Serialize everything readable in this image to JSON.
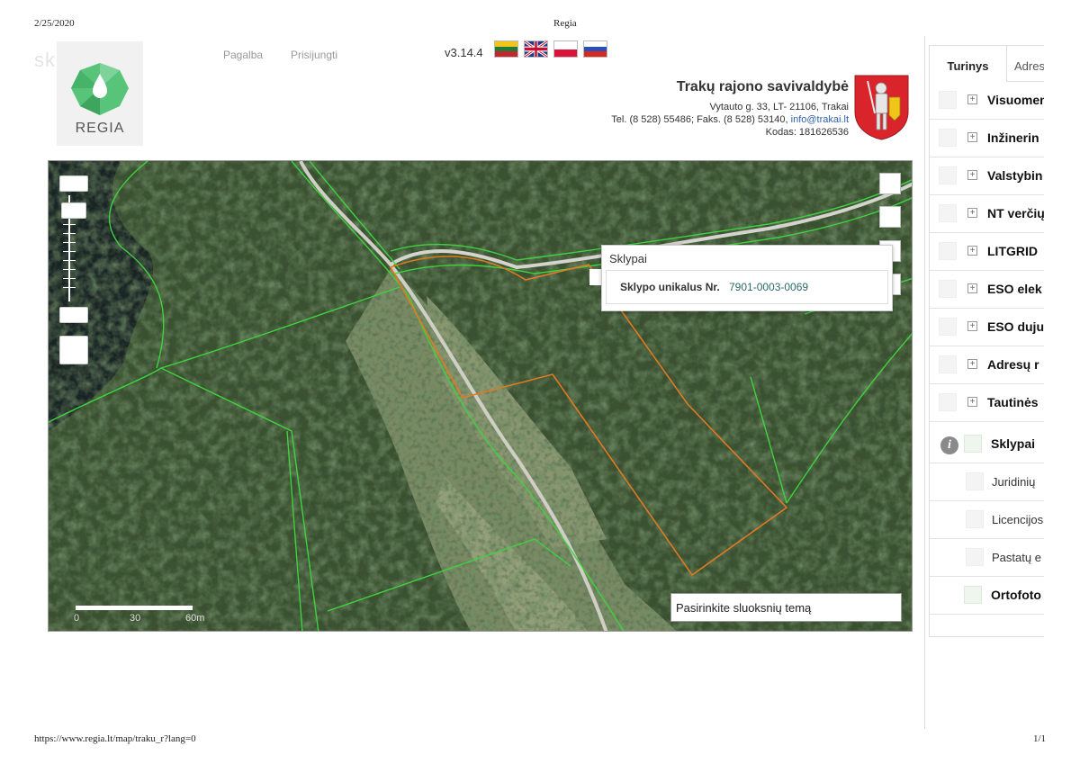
{
  "print": {
    "date": "2/25/2020",
    "title": "Regia",
    "url": "https://www.regia.lt/map/traku_r?lang=0",
    "pages": "1/1"
  },
  "header": {
    "watermark": "skelbiu.lt",
    "logo_text": "REGIA",
    "nav": {
      "help": "Pagalba",
      "login": "Prisijungti"
    },
    "version": "v3.14.4",
    "languages": [
      "lt-flag",
      "en-flag",
      "pl-flag",
      "ru-flag"
    ]
  },
  "org": {
    "name": "Trakų rajono savivaldybė",
    "address": "Vytauto g. 33, LT- 21106, Trakai",
    "contacts": "Tel. (8 528) 55486; Faks. (8 528) 53140,",
    "email": "info@trakai.lt",
    "code": "Kodas: 181626536"
  },
  "map": {
    "scale_labels": [
      "0",
      "30",
      "60m"
    ],
    "theme_select": "Pasirinkite sluoksnių temą",
    "popup": {
      "title": "Sklypai",
      "label": "Sklypo unikalus Nr.",
      "value": "7901-0003-0069"
    },
    "colors": {
      "parcel_boundary": "#3fd23f",
      "selected_parcel": "#e07a22"
    }
  },
  "panel": {
    "tabs": [
      "Turinys",
      "Adres"
    ],
    "layers": [
      "Visuomen",
      "Inžinerin",
      "Valstybin",
      "NT verčių",
      "LITGRID",
      "ESO elek",
      "ESO duju",
      "Adresų r",
      "Tautinės"
    ],
    "active_layer": "Sklypai",
    "sublayers": [
      "Juridinių",
      "Licencijos",
      "Pastatų e"
    ],
    "last_layer": "Ortofoto"
  }
}
